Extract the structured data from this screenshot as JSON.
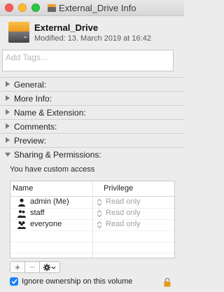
{
  "window": {
    "title": "External_Drive Info"
  },
  "header": {
    "name": "External_Drive",
    "modified": "Modified: 13. March 2019 at 16:42"
  },
  "tags": {
    "placeholder": "Add Tags..."
  },
  "sections": [
    {
      "label": "General:"
    },
    {
      "label": "More Info:"
    },
    {
      "label": "Name & Extension:"
    },
    {
      "label": "Comments:"
    },
    {
      "label": "Preview:"
    },
    {
      "label": "Sharing & Permissions:"
    }
  ],
  "permissions": {
    "access_text": "You have custom access",
    "columns": {
      "name": "Name",
      "privilege": "Privilege"
    },
    "rows": [
      {
        "name": "admin (Me)",
        "privilege": "Read only",
        "icon": "user-icon"
      },
      {
        "name": "staff",
        "privilege": "Read only",
        "icon": "group-icon"
      },
      {
        "name": "everyone",
        "privilege": "Read only",
        "icon": "everyone-icon"
      }
    ],
    "ignore_ownership": "Ignore ownership on this volume",
    "ignore_checked": true
  },
  "toolbar": {
    "add": "+",
    "remove": "−"
  },
  "colors": {
    "accent": "#1a82fb",
    "drive_top": "#f0a02a"
  }
}
